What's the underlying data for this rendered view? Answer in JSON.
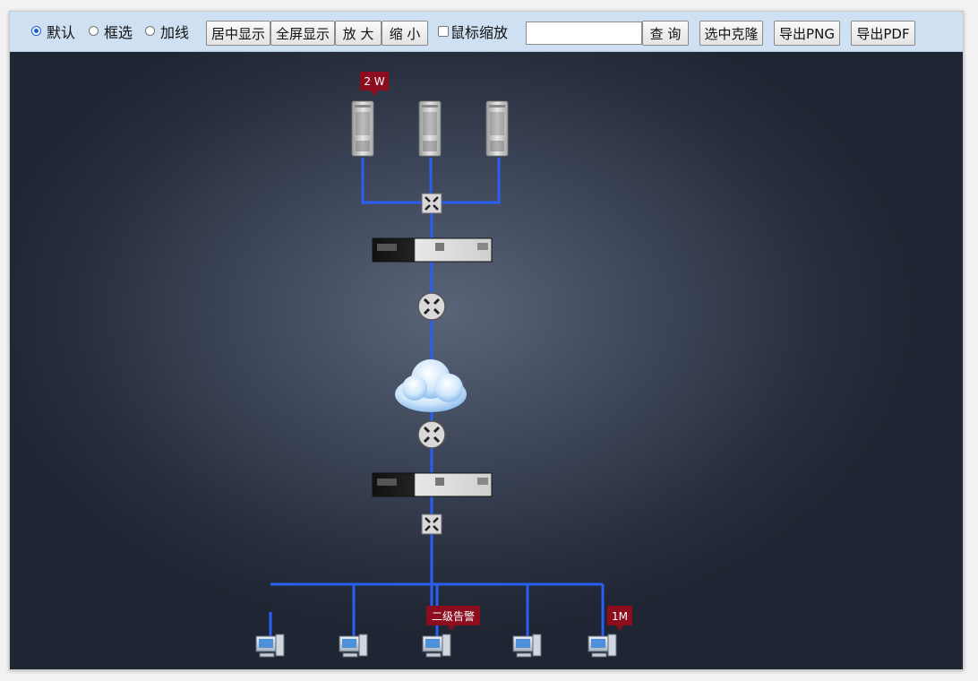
{
  "toolbar": {
    "modes": [
      {
        "label": "默认",
        "selected": true
      },
      {
        "label": "框选",
        "selected": false
      },
      {
        "label": "加线",
        "selected": false
      }
    ],
    "buttons": {
      "center": "居中显示",
      "fullscreen": "全屏显示",
      "zoom_in": "放 大",
      "zoom_out": "缩 小",
      "search": "查 询",
      "clone": "选中克隆",
      "export_png": "导出PNG",
      "export_pdf": "导出PDF"
    },
    "mouse_zoom": {
      "label": "鼠标缩放",
      "checked": false
    },
    "search_value": ""
  },
  "topology": {
    "colors": {
      "link": "#2a5ff5",
      "alarm": "#8b0d1e"
    },
    "alarms": {
      "server": "2 W",
      "client_mid": "二级告警",
      "client_right": "1M"
    },
    "nodes": {
      "servers": [
        "server",
        "server",
        "server"
      ],
      "top_switch": "switch",
      "top_firewall": "firewall",
      "top_router": "router",
      "cloud": "cloud",
      "bottom_router": "router",
      "bottom_firewall": "firewall",
      "bottom_switch": "switch",
      "clients": [
        "pc",
        "pc",
        "pc",
        "pc",
        "pc"
      ]
    }
  }
}
